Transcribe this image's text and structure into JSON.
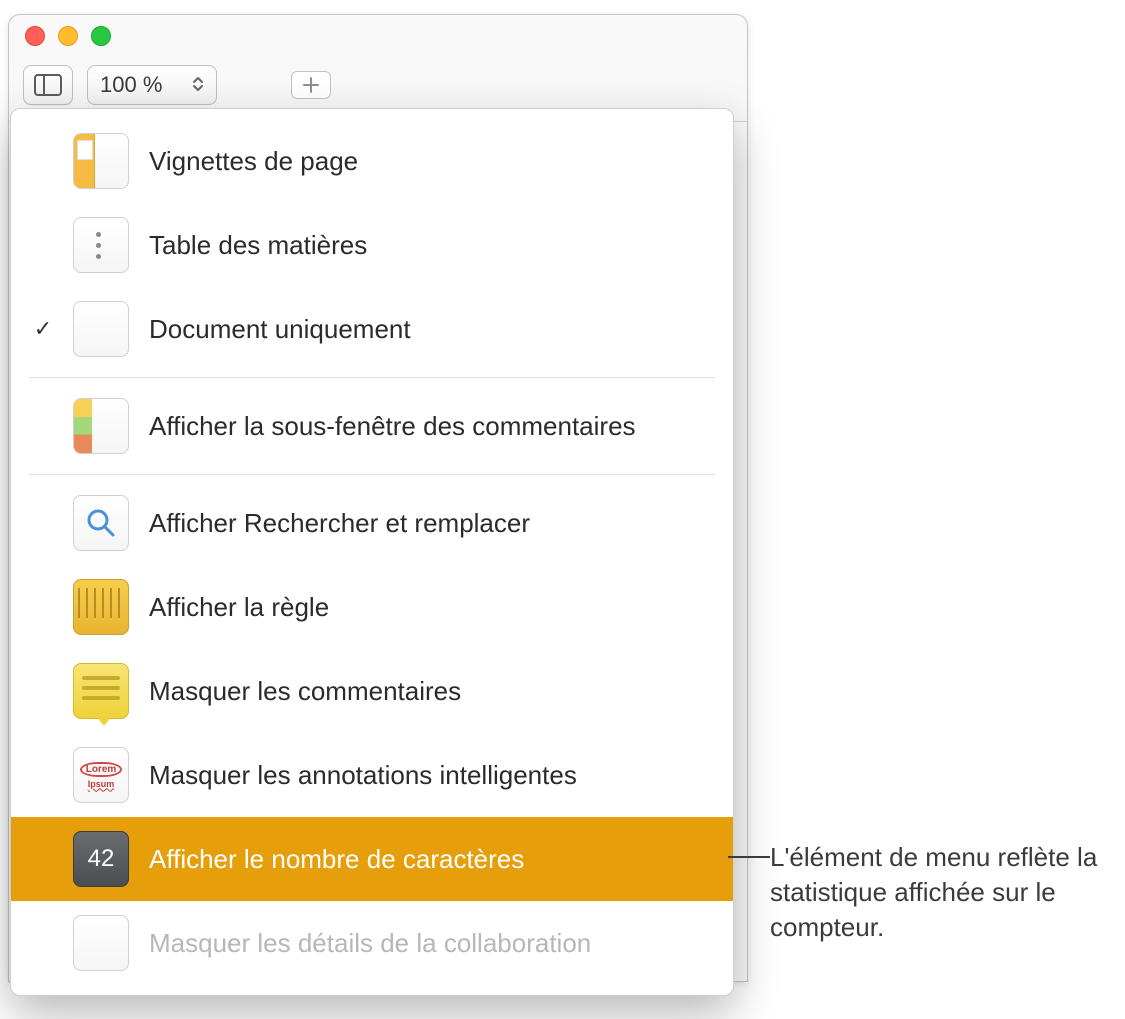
{
  "toolbar": {
    "zoom_value": "100 %"
  },
  "menu": {
    "items": [
      {
        "label": "Vignettes de page",
        "checked": false,
        "highlighted": false,
        "disabled": false,
        "icon": "page-thumbnails-icon"
      },
      {
        "label": "Table des matières",
        "checked": false,
        "highlighted": false,
        "disabled": false,
        "icon": "toc-icon"
      },
      {
        "label": "Document uniquement",
        "checked": true,
        "highlighted": false,
        "disabled": false,
        "icon": "document-only-icon"
      },
      {
        "sep": true
      },
      {
        "label": "Afficher la sous-fenêtre des commentaires",
        "checked": false,
        "highlighted": false,
        "disabled": false,
        "icon": "comments-pane-icon"
      },
      {
        "sep": true
      },
      {
        "label": "Afficher Rechercher et remplacer",
        "checked": false,
        "highlighted": false,
        "disabled": false,
        "icon": "search-icon"
      },
      {
        "label": "Afficher la règle",
        "checked": false,
        "highlighted": false,
        "disabled": false,
        "icon": "ruler-icon"
      },
      {
        "label": "Masquer les commentaires",
        "checked": false,
        "highlighted": false,
        "disabled": false,
        "icon": "note-icon"
      },
      {
        "label": "Masquer les annotations intelligentes",
        "checked": false,
        "highlighted": false,
        "disabled": false,
        "icon": "smart-annotations-icon"
      },
      {
        "label": "Afficher le nombre de caractères",
        "checked": false,
        "highlighted": true,
        "disabled": false,
        "icon": "word-count-icon"
      },
      {
        "label": "Masquer les détails de la collaboration",
        "checked": false,
        "highlighted": false,
        "disabled": true,
        "icon": "collaboration-details-icon"
      }
    ],
    "count_badge": "42"
  },
  "callout": {
    "text": "L'élément de menu reflète la statistique affichée sur le compteur."
  }
}
